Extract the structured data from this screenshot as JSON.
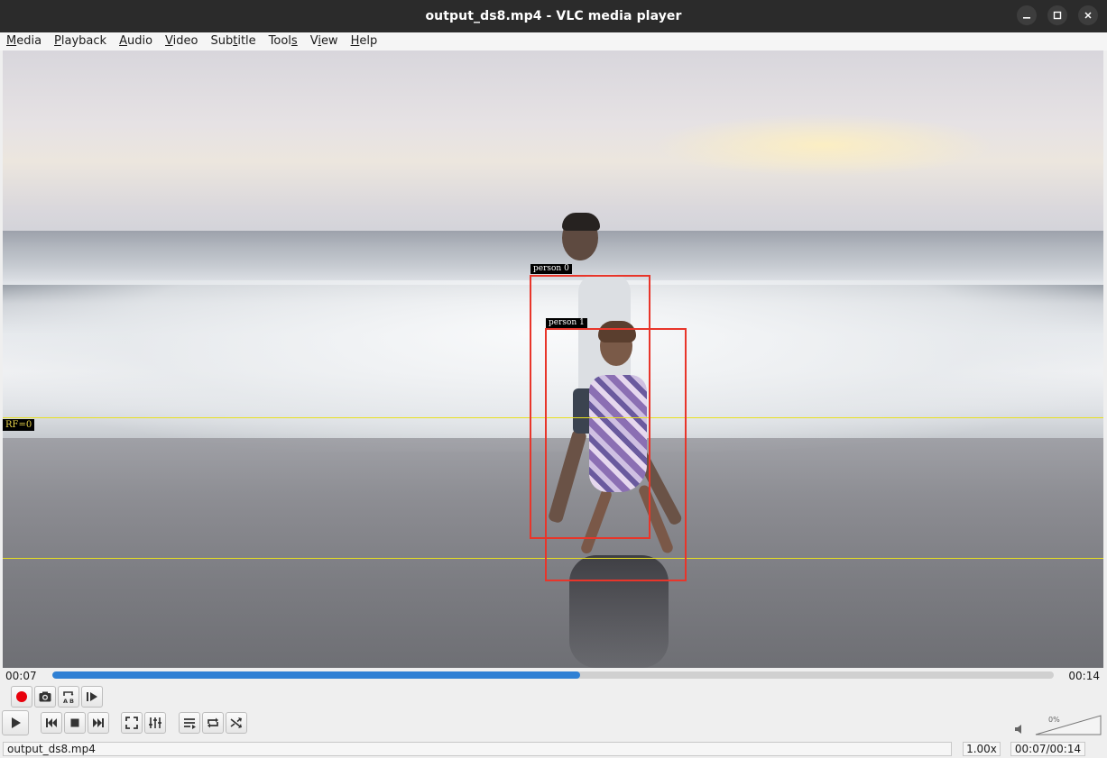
{
  "window": {
    "title": "output_ds8.mp4 - VLC media player"
  },
  "menubar": {
    "items": [
      {
        "pre": "",
        "ul": "M",
        "post": "edia"
      },
      {
        "pre": "",
        "ul": "P",
        "post": "layback"
      },
      {
        "pre": "",
        "ul": "A",
        "post": "udio"
      },
      {
        "pre": "",
        "ul": "V",
        "post": "ideo"
      },
      {
        "pre": "Sub",
        "ul": "t",
        "post": "itle"
      },
      {
        "pre": "Tool",
        "ul": "s",
        "post": ""
      },
      {
        "pre": "V",
        "ul": "i",
        "post": "ew"
      },
      {
        "pre": "",
        "ul": "H",
        "post": "elp"
      }
    ]
  },
  "video": {
    "detections": [
      {
        "label": "person 0"
      },
      {
        "label": "person 1"
      }
    ],
    "zone_label": "RF=0"
  },
  "seek": {
    "elapsed": "00:07",
    "total": "00:14",
    "progress": 0.527
  },
  "controls": {
    "icons": [
      "record-icon",
      "snapshot-icon",
      "ab-loop-icon",
      "frame-step-icon",
      "play-icon",
      "previous-icon",
      "stop-icon",
      "next-icon",
      "fullscreen-icon",
      "extended-settings-icon",
      "playlist-icon",
      "loop-icon",
      "shuffle-icon"
    ]
  },
  "volume": {
    "percent_label": "0%",
    "level": 0.0
  },
  "statusbar": {
    "filename": "output_ds8.mp4",
    "rate": "1.00x",
    "time": "00:07/00:14"
  },
  "colors": {
    "accent": "#2f80d4",
    "record": "#e8000b",
    "bbox": "#e8352a",
    "zone": "#e8e021"
  }
}
